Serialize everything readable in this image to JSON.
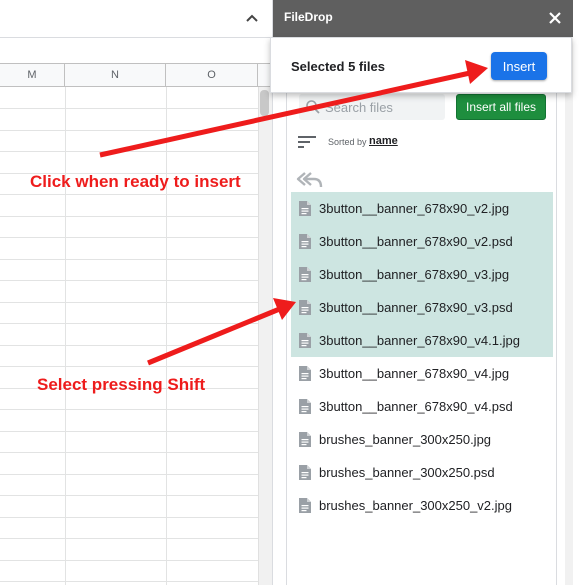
{
  "sheet": {
    "columns": [
      "M",
      "N",
      "O"
    ]
  },
  "sidebar": {
    "title": "FileDrop",
    "close_icon": "close-icon"
  },
  "popover": {
    "selected_text": "Selected 5 files",
    "insert_label": "Insert",
    "insert_color": "#1a73e8"
  },
  "toolbar": {
    "search_placeholder": "Search files",
    "insert_all_label": "Insert all files",
    "insert_all_color": "#1e8e3e",
    "sorted_by_label": "Sorted by",
    "sort_field": "name"
  },
  "files": [
    {
      "name": "3button__banner_678x90_v2.jpg",
      "selected": true
    },
    {
      "name": "3button__banner_678x90_v2.psd",
      "selected": true
    },
    {
      "name": "3button__banner_678x90_v3.jpg",
      "selected": true
    },
    {
      "name": "3button__banner_678x90_v3.psd",
      "selected": true
    },
    {
      "name": "3button__banner_678x90_v4.1.jpg",
      "selected": true
    },
    {
      "name": "3button__banner_678x90_v4.jpg",
      "selected": false
    },
    {
      "name": "3button__banner_678x90_v4.psd",
      "selected": false
    },
    {
      "name": "brushes_banner_300x250.jpg",
      "selected": false
    },
    {
      "name": "brushes_banner_300x250.psd",
      "selected": false
    },
    {
      "name": "brushes_banner_300x250_v2.jpg",
      "selected": false
    }
  ],
  "selection_color": "#cde5e1",
  "annotations": {
    "insert_hint": "Click when ready to insert",
    "shift_hint": "Select pressing Shift",
    "color": "#ee1c1c"
  }
}
